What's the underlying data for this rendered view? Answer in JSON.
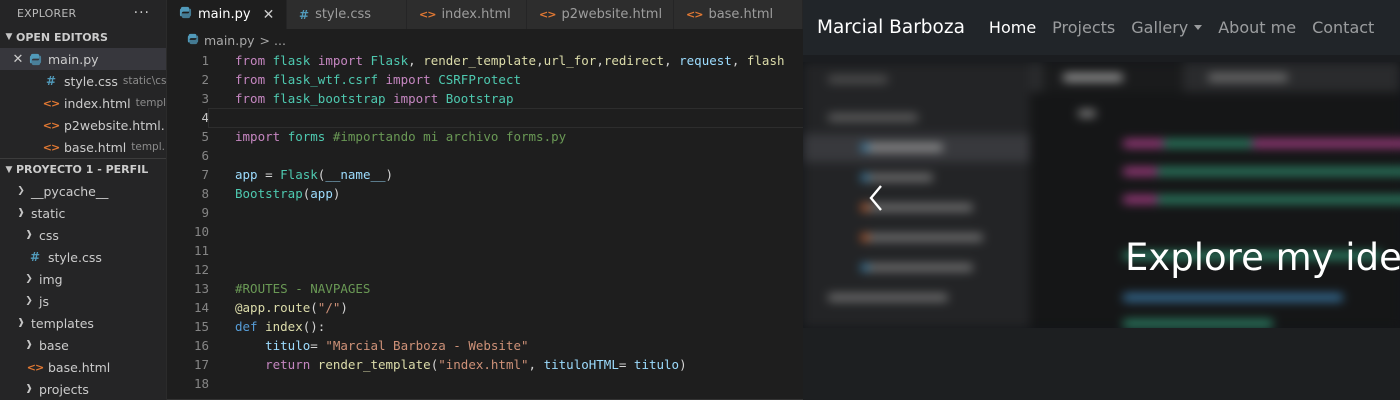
{
  "explorer": {
    "title": "EXPLORER",
    "more_label": "···",
    "open_editors_title": "OPEN EDITORS",
    "open_editors": [
      {
        "name": "main.py",
        "hint": "",
        "icon": "python-file-icon",
        "active": true
      },
      {
        "name": "style.css",
        "hint": "static\\css",
        "icon": "css-file-icon"
      },
      {
        "name": "index.html",
        "hint": "templ...",
        "icon": "html-file-icon"
      },
      {
        "name": "p2website.html...",
        "hint": "",
        "icon": "html-file-icon"
      },
      {
        "name": "base.html",
        "hint": "templ...",
        "icon": "html-file-icon"
      }
    ],
    "project_title": "PROYECTO 1 - PERFIL",
    "tree": [
      {
        "name": "__pycache__",
        "type": "folder-collapsed"
      },
      {
        "name": "static",
        "type": "folder-open"
      },
      {
        "name": "css",
        "type": "folder-open"
      },
      {
        "name": "style.css",
        "type": "css"
      },
      {
        "name": "img",
        "type": "folder-collapsed"
      },
      {
        "name": "js",
        "type": "folder-collapsed"
      },
      {
        "name": "templates",
        "type": "folder-open"
      },
      {
        "name": "base",
        "type": "folder-open"
      },
      {
        "name": "base.html",
        "type": "html"
      },
      {
        "name": "projects",
        "type": "folder-open"
      }
    ]
  },
  "tabs": [
    {
      "label": "main.py",
      "icon": "python-file-icon",
      "active": true
    },
    {
      "label": "style.css",
      "icon": "css-file-icon"
    },
    {
      "label": "index.html",
      "icon": "html-file-icon"
    },
    {
      "label": "p2website.html",
      "icon": "html-file-icon"
    },
    {
      "label": "base.html",
      "icon": "html-file-icon"
    }
  ],
  "breadcrumb": {
    "file": "main.py",
    "rest": "> ..."
  },
  "code": {
    "line_numbers": [
      "1",
      "2",
      "3",
      "4",
      "5",
      "6",
      "7",
      "8",
      "9",
      "10",
      "11",
      "12",
      "13",
      "14",
      "15",
      "16",
      "17",
      "18"
    ],
    "current_line": "4"
  },
  "site": {
    "brand": "Marcial Barboza",
    "nav": [
      {
        "label": "Home",
        "active": true
      },
      {
        "label": "Projects"
      },
      {
        "label": "Gallery",
        "dropdown": true
      },
      {
        "label": "About me"
      },
      {
        "label": "Contact"
      }
    ],
    "carousel_caption": "Explore my ideas"
  },
  "colors": {
    "sidebar_bg": "#252526",
    "editor_bg": "#1e1e1e",
    "navbar_bg": "#212529",
    "python_icon": "#519aba",
    "html_icon": "#e37933"
  }
}
